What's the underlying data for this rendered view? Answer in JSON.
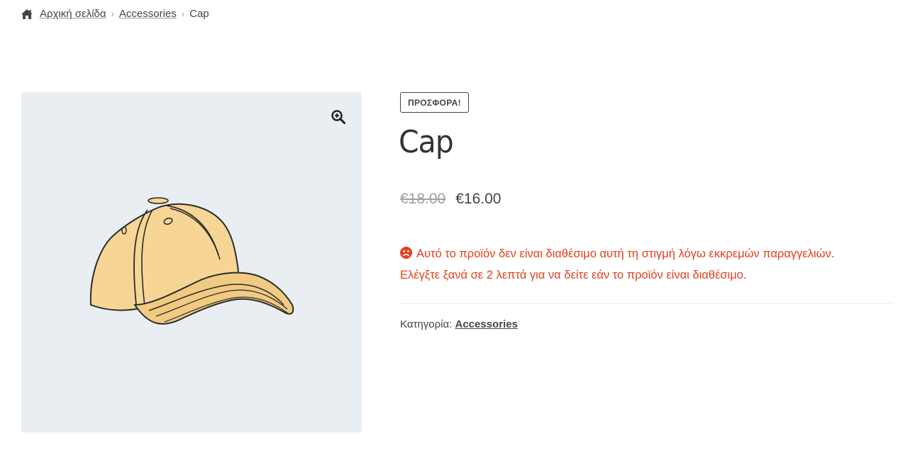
{
  "breadcrumb": {
    "home_label": "Αρχική σελίδα",
    "category_label": "Accessories",
    "current_label": "Cap",
    "separator": "›"
  },
  "gallery": {
    "zoom_icon": "zoom-in-icon",
    "image_alt": "cap"
  },
  "product": {
    "sale_badge": "ΠΡΟΣΦΟΡΑ!",
    "title": "Cap",
    "old_price": "€18.00",
    "new_price": "€16.00",
    "stock_notice_line1": "Αυτό το προϊόν δεν είναι διαθέσιμο αυτή τη στιγμή λόγω εκκρεμών παραγγελιών.",
    "stock_notice_line2": "Ελέγξτε ξανά σε 2 λεπτά για να δείτε εάν το προϊόν είναι διαθέσιμο.",
    "category_prefix": "Κατηγορία:",
    "category_link": "Accessories"
  },
  "colors": {
    "text": "#43454b",
    "error": "#e2401c",
    "gallery_bg": "#e9eef2",
    "muted": "#a0a0a0"
  }
}
